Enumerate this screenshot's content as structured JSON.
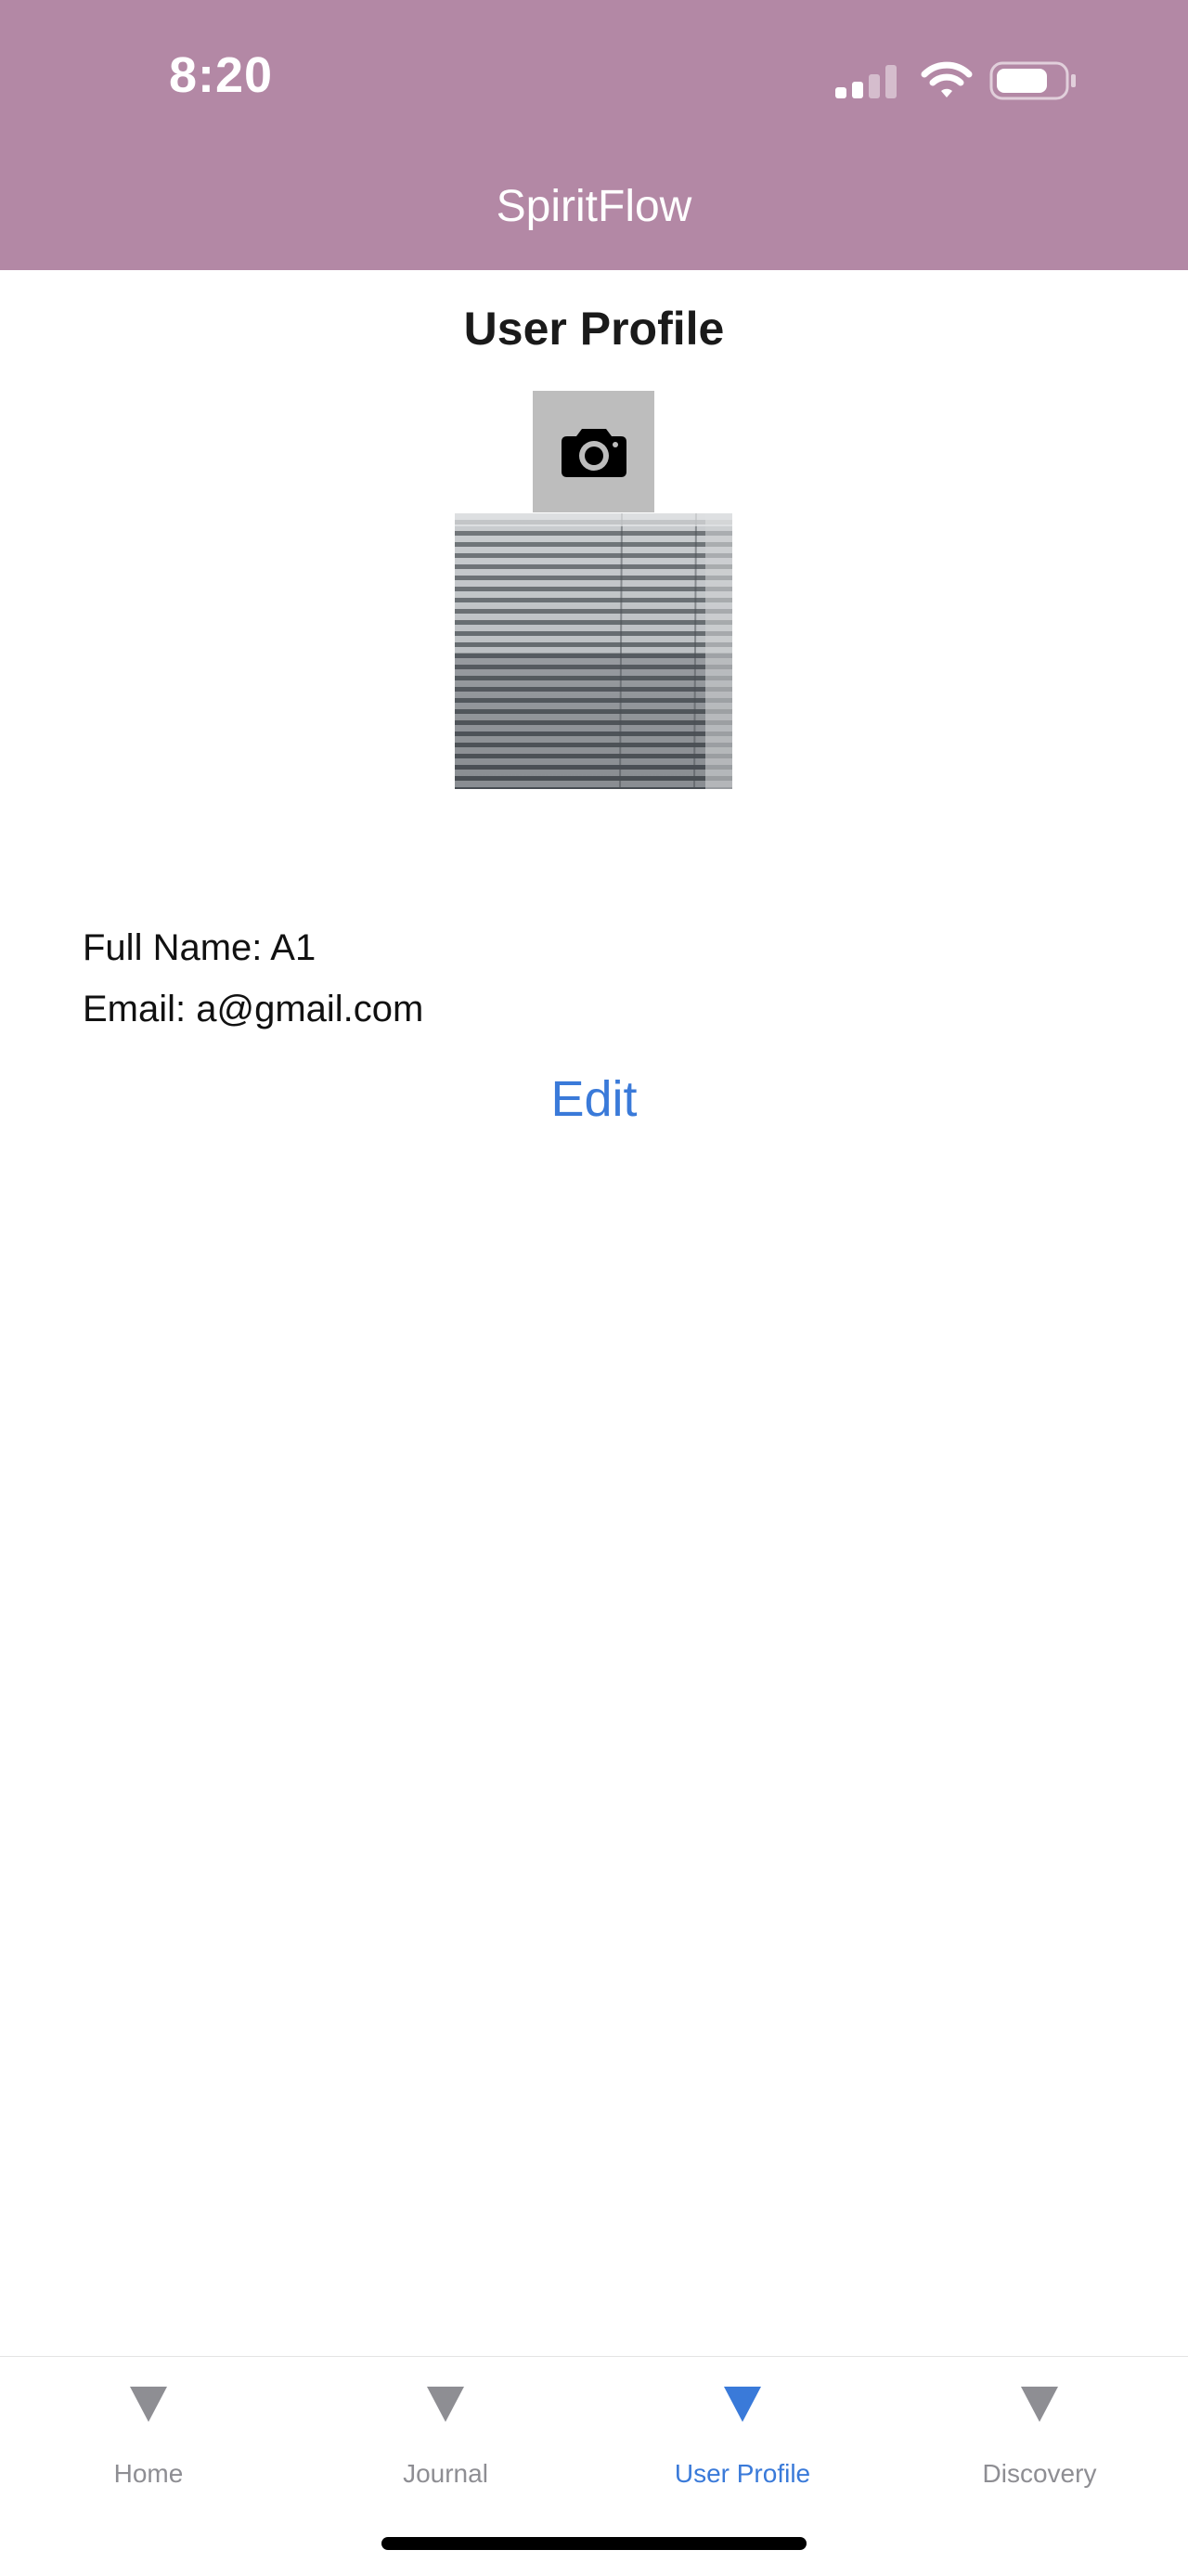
{
  "status_bar": {
    "time": "8:20",
    "signal_icon": "cellular-signal-icon",
    "wifi_icon": "wifi-icon",
    "battery_icon": "battery-icon"
  },
  "header": {
    "title": "SpiritFlow",
    "background_color": "#b388a5"
  },
  "main": {
    "page_title": "User Profile",
    "camera_button_icon": "camera-icon",
    "profile_photo": "photo of window blinds",
    "full_name_text": "Full Name: A1",
    "email_text": "Email: a@gmail.com",
    "edit_label": "Edit",
    "accent_color": "#3a7ad9"
  },
  "tabbar": {
    "tabs": [
      {
        "label": "Home",
        "icon": "triangle-down-icon",
        "active": false
      },
      {
        "label": "Journal",
        "icon": "triangle-down-icon",
        "active": false
      },
      {
        "label": "User Profile",
        "icon": "triangle-down-icon",
        "active": true
      },
      {
        "label": "Discovery",
        "icon": "triangle-down-icon",
        "active": false
      }
    ]
  }
}
